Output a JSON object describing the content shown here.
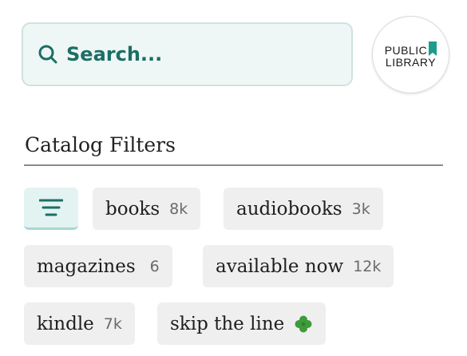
{
  "search": {
    "placeholder": "Search..."
  },
  "logo": {
    "line1": "PUBLIC",
    "line2": "LIBRARY"
  },
  "filters": {
    "title": "Catalog Filters",
    "chips": [
      {
        "label": "books",
        "count": "8k"
      },
      {
        "label": "audiobooks",
        "count": "3k"
      },
      {
        "label": "magazines",
        "count": "6"
      },
      {
        "label": "available now",
        "count": "12k"
      },
      {
        "label": "kindle",
        "count": "7k"
      },
      {
        "label": "skip the line",
        "icon": "clover-icon"
      }
    ]
  },
  "colors": {
    "accent": "#1c6e66",
    "search_bg": "#eef7f5",
    "chip_bg": "#efefef",
    "filter_button_bg": "#e3f3f1",
    "clover": "#3e9a3a"
  }
}
